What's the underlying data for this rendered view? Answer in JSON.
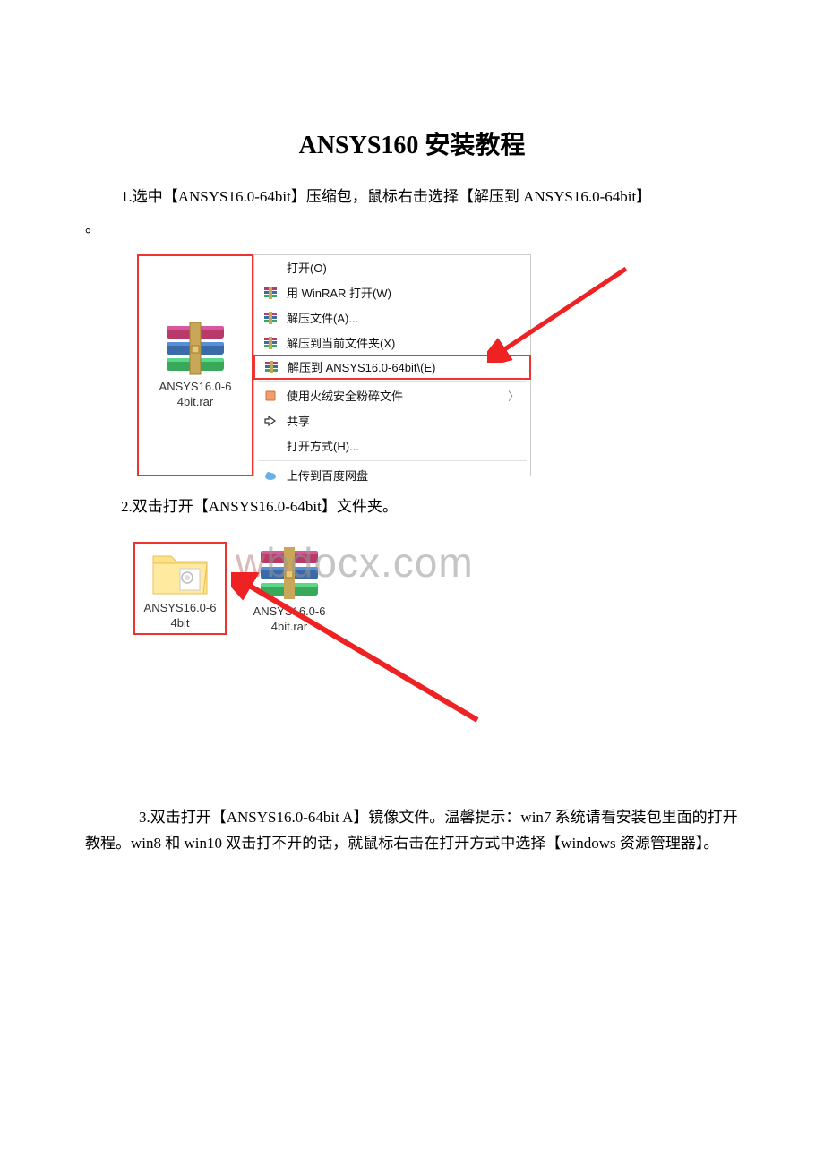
{
  "title": "ANSYS160 安装教程",
  "step1": "1.选中【ANSYS16.0-64bit】压缩包，鼠标右击选择【解压到 ANSYS16.0-64bit】",
  "orphan": "。",
  "step2": "2.双击打开【ANSYS16.0-64bit】文件夹。",
  "step3": "3.双击打开【ANSYS16.0-64bit A】镜像文件。温馨提示：win7 系统请看安装包里面的打开教程。win8 和 win10 双击打不开的话，就鼠标右击在打开方式中选择【windows 资源管理器】。",
  "shot1": {
    "rar_label_l1": "ANSYS16.0-6",
    "rar_label_l2": "4bit.rar",
    "menu": {
      "open": "打开(O)",
      "open_winrar": "用 WinRAR 打开(W)",
      "extract_files": "解压文件(A)...",
      "extract_here": "解压到当前文件夹(X)",
      "extract_to": "解压到 ANSYS16.0-64bit\\(E)",
      "shred": "使用火绒安全粉碎文件",
      "share": "共享",
      "open_with": "打开方式(H)...",
      "upload_baidu": "上传到百度网盘"
    }
  },
  "shot2": {
    "folder_label_l1": "ANSYS16.0-6",
    "folder_label_l2": "4bit",
    "rar_label_l1": "ANSYS16.0-6",
    "rar_label_l2": "4bit.rar"
  },
  "watermark": {
    "w1": "w",
    "rest": "bdocx.com"
  }
}
